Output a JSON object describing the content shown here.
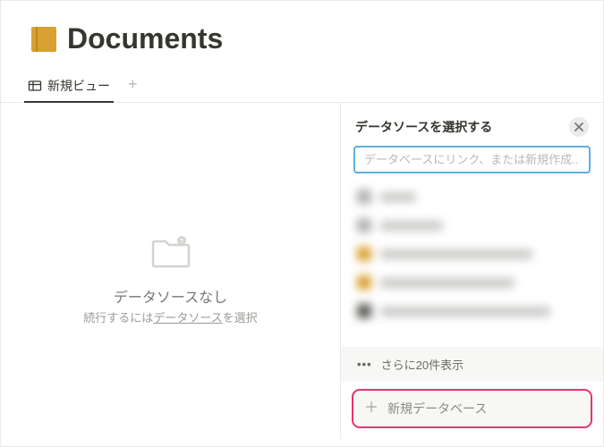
{
  "header": {
    "title": "Documents"
  },
  "tabs": {
    "active": "新規ビュー"
  },
  "empty": {
    "title": "データソースなし",
    "sub_prefix": "続行するには",
    "sub_link": "データソース",
    "sub_suffix": "を選択"
  },
  "panel": {
    "title": "データソースを選択する",
    "search_placeholder": "データベースにリンク、または新規作成...",
    "show_more": "さらに20件表示",
    "new_db": "新規データベース"
  },
  "accent_highlight": "#e6346a",
  "icon_orange": "#d9a032"
}
